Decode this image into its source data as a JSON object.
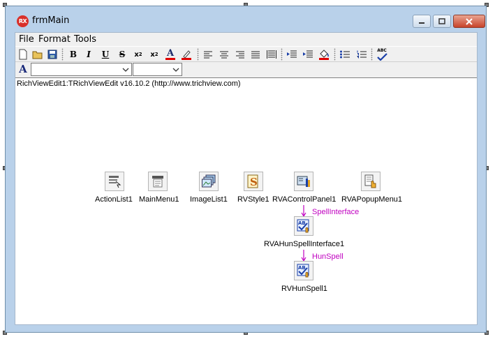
{
  "window": {
    "title": "frmMain",
    "icon_text": "RX"
  },
  "menu": [
    {
      "label": "File"
    },
    {
      "label": "Format"
    },
    {
      "label": "Tools"
    }
  ],
  "toolbar": {
    "bold": "B",
    "italic": "I",
    "underline": "U",
    "strike": "S",
    "subscript": "x",
    "sub_index": "2",
    "superscript": "x",
    "sup_index": "2",
    "font_color": "A",
    "font_label": "A",
    "spell": "ABC"
  },
  "editor": {
    "caption": "RichViewEdit1:TRichViewEdit v16.10.2 (http://www.trichview.com)"
  },
  "components": [
    {
      "label": "ActionList1"
    },
    {
      "label": "MainMenu1"
    },
    {
      "label": "ImageList1"
    },
    {
      "label": "RVStyle1"
    },
    {
      "label": "RVAControlPanel1"
    },
    {
      "label": "RVAPopupMenu1"
    },
    {
      "label": "RVAHunSpellInterface1"
    },
    {
      "label": "RVHunSpell1"
    }
  ],
  "links": [
    {
      "label": "SpellInterface"
    },
    {
      "label": "HunSpell"
    }
  ],
  "colors": {
    "link": "#c000c0",
    "title_bg": "#b9d1ea",
    "close_red": "#c7432a"
  }
}
